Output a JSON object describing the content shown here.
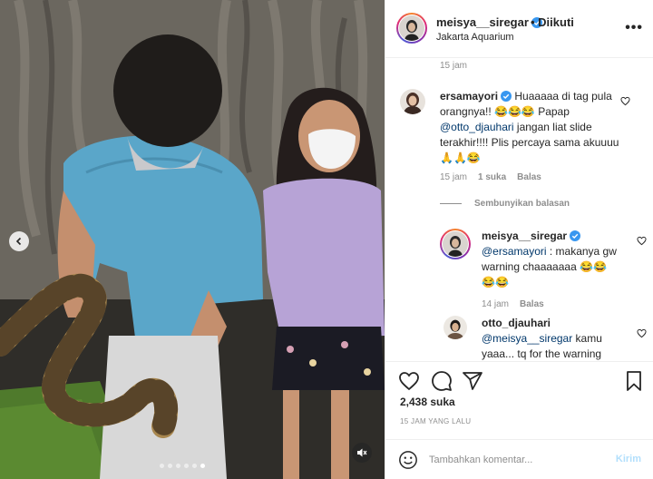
{
  "post": {
    "username": "meisya__siregar",
    "follow_status": "• Diikuti",
    "location": "Jakarta Aquarium",
    "more": "•••"
  },
  "caption_time": "15 jam",
  "comments": [
    {
      "username": "ersamayori",
      "verified": true,
      "text_pre": " Huaaaaa di tag pula orangnya!! 😂😂😂 Papap ",
      "mention": "@otto_djauhari",
      "text_post": " jangan liat slide terakhir!!!! Plis percaya sama akuuuu 🙏🙏😂",
      "time": "15 jam",
      "likes": "1 suka",
      "reply": "Balas"
    }
  ],
  "hide_replies": "Sembunyikan balasan",
  "replies": [
    {
      "username": "meisya__siregar",
      "verified": true,
      "mention": "@ersamayori",
      "text": " : makanya gw warning chaaaaaaa 😂😂😂😂",
      "time": "14 jam",
      "reply": "Balas"
    },
    {
      "username": "otto_djauhari",
      "mention": "@meisya__siregar",
      "text": " kamu yaaa... tq for the warning"
    }
  ],
  "likes_count": "2,438 suka",
  "posted_ago": "15 JAM YANG LALU",
  "composer": {
    "placeholder": "Tambahkan komentar...",
    "send": "Kirim"
  },
  "carousel": {
    "count": 6,
    "active": 5
  },
  "icons": [
    "chevron-left-icon",
    "mute-icon",
    "heart-icon",
    "comment-icon",
    "share-icon",
    "bookmark-icon",
    "emoji-icon",
    "verified-icon"
  ],
  "colors": {
    "verified": "#3897f0",
    "mention": "#00376b",
    "send_disabled": "#b2dffc",
    "muted_text": "#8e8e8e"
  }
}
